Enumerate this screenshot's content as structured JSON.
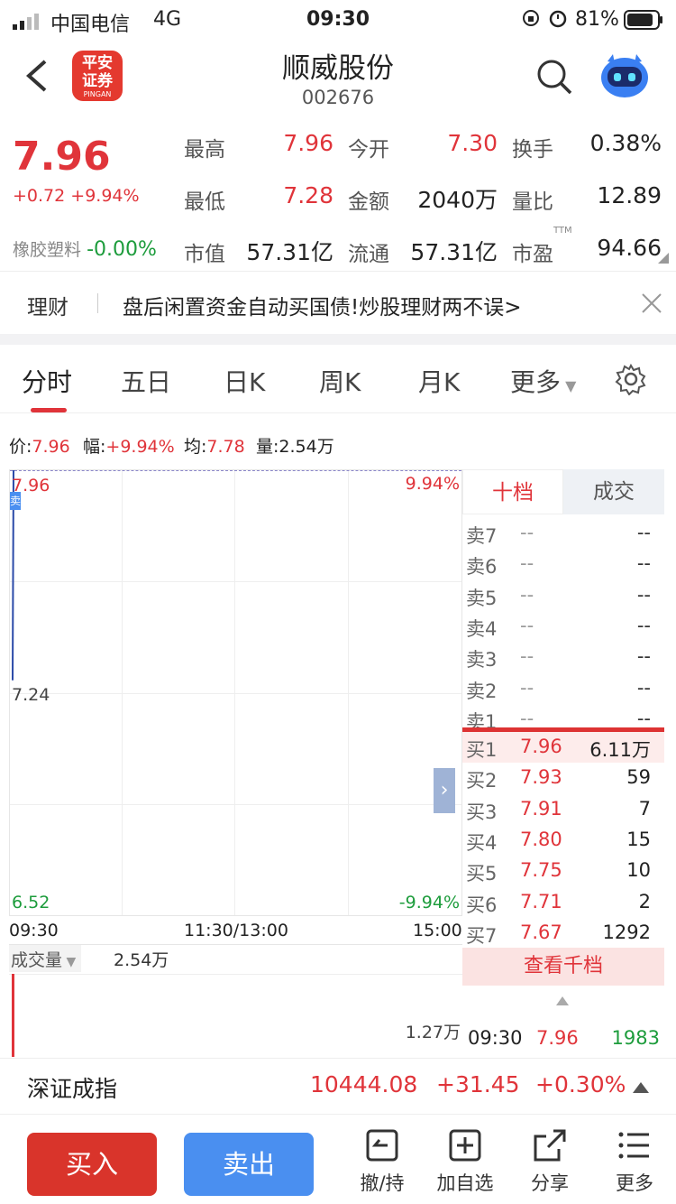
{
  "status_bar": {
    "carrier": "中国电信",
    "network": "4G",
    "time": "09:30",
    "battery": "81%"
  },
  "header": {
    "logo_text_1": "平安",
    "logo_text_2": "证券",
    "logo_sub": "PINGAN",
    "title": "顺威股份",
    "code": "002676"
  },
  "quote": {
    "price": "7.96",
    "change": "+0.72",
    "change_pct": "+9.94%",
    "sector": "橡胶塑料",
    "sector_change": "-0.00%",
    "high_label": "最高",
    "high": "7.96",
    "open_label": "今开",
    "open": "7.30",
    "turnover_label": "换手",
    "turnover": "0.38%",
    "low_label": "最低",
    "low": "7.28",
    "amount_label": "金额",
    "amount": "2040万",
    "vol_ratio_label": "量比",
    "vol_ratio": "12.89",
    "mcap_label": "市值",
    "mcap": "57.31亿",
    "float_label": "流通",
    "float": "57.31亿",
    "pe_label": "市盈",
    "pe_sup": "TTM",
    "pe": "94.66"
  },
  "banner": {
    "tag": "理财",
    "text": "盘后闲置资金自动买国债!炒股理财两不误>"
  },
  "tabs": [
    "分时",
    "五日",
    "日K",
    "周K",
    "月K",
    "更多"
  ],
  "info_bar": {
    "price_label": "价:",
    "price": "7.96",
    "amp_label": "幅:",
    "amp": "+9.94%",
    "avg_label": "均:",
    "avg": "7.78",
    "vol_label": "量:",
    "vol": "2.54万"
  },
  "chart_data": {
    "type": "line",
    "y_top": "7.96",
    "y_mid": "7.24",
    "y_bottom": "6.52",
    "pct_top": "9.94%",
    "pct_bottom": "-9.94%",
    "x_labels": [
      "09:30",
      "11:30/13:00",
      "15:00"
    ],
    "x": [
      "09:30"
    ],
    "series": [
      {
        "values": [
          7.28,
          7.96
        ]
      }
    ],
    "ylim": [
      6.52,
      7.96
    ]
  },
  "volume": {
    "label": "成交量",
    "value": "2.54万",
    "axis": "1.27万"
  },
  "order_book": {
    "tab_active": "十档",
    "tab_other": "成交",
    "asks": [
      {
        "label": "卖7",
        "price": "--",
        "vol": "--"
      },
      {
        "label": "卖6",
        "price": "--",
        "vol": "--"
      },
      {
        "label": "卖5",
        "price": "--",
        "vol": "--"
      },
      {
        "label": "卖4",
        "price": "--",
        "vol": "--"
      },
      {
        "label": "卖3",
        "price": "--",
        "vol": "--"
      },
      {
        "label": "卖2",
        "price": "--",
        "vol": "--"
      },
      {
        "label": "卖1",
        "price": "--",
        "vol": "--"
      }
    ],
    "bids": [
      {
        "label": "买1",
        "price": "7.96",
        "vol": "6.11万"
      },
      {
        "label": "买2",
        "price": "7.93",
        "vol": "59"
      },
      {
        "label": "买3",
        "price": "7.91",
        "vol": "7"
      },
      {
        "label": "买4",
        "price": "7.80",
        "vol": "15"
      },
      {
        "label": "买5",
        "price": "7.75",
        "vol": "10"
      },
      {
        "label": "买6",
        "price": "7.71",
        "vol": "2"
      },
      {
        "label": "买7",
        "price": "7.67",
        "vol": "1292"
      }
    ],
    "view_more": "查看千档",
    "trade": {
      "time": "09:30",
      "price": "7.96",
      "vol": "1983"
    }
  },
  "index": {
    "name": "深证成指",
    "value": "10444.08",
    "change": "+31.45",
    "pct": "+0.30%"
  },
  "toolbar": {
    "buy": "买入",
    "sell": "卖出",
    "cancel": "撤/持",
    "add_fav": "加自选",
    "share": "分享",
    "more": "更多"
  },
  "colors": {
    "up": "#e0343a",
    "down": "#1d9c3c",
    "buy_btn": "#d9342b",
    "sell_btn": "#4a8ff0"
  }
}
